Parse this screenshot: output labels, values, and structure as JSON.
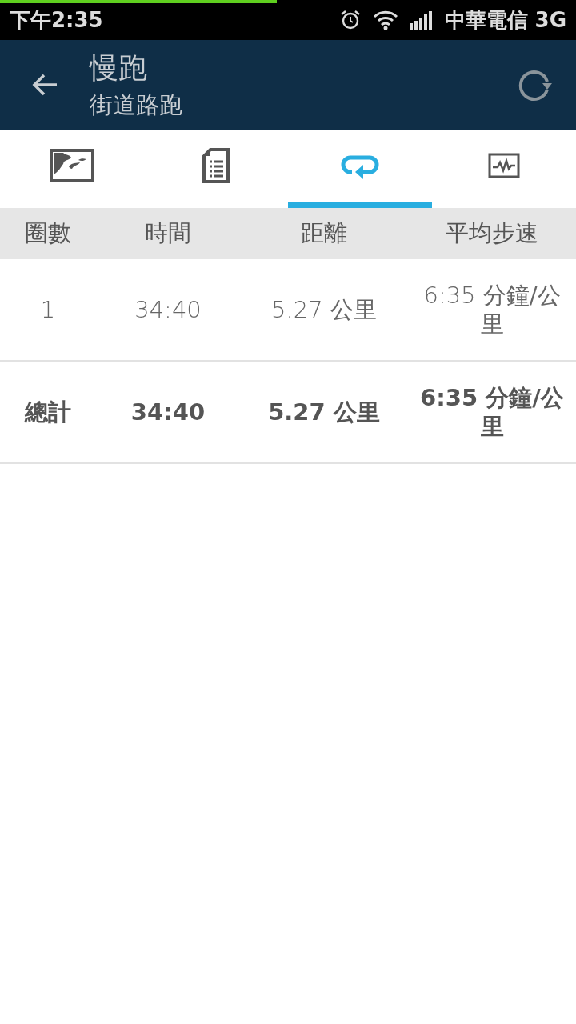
{
  "status_bar": {
    "time": "下午2:35",
    "carrier": "中華電信 3G",
    "progress": {
      "level": 0.48
    }
  },
  "app_bar": {
    "title": "慢跑",
    "subtitle": "街道路跑"
  },
  "tabs": [
    {
      "selected": false
    },
    {
      "selected": false
    },
    {
      "selected": true
    },
    {
      "selected": false
    }
  ],
  "table": {
    "columns": [
      "圈數",
      "時間",
      "距離",
      "平均步速"
    ],
    "rows": [
      {
        "kind": "lap",
        "cells": [
          "1",
          "34:40",
          "5.27 **公里**",
          "6:35 **分鐘/公里**"
        ]
      },
      {
        "kind": "total",
        "cells": [
          "總計",
          "34:40",
          "5.27 公里",
          "6:35 分鐘/公里"
        ]
      }
    ]
  }
}
